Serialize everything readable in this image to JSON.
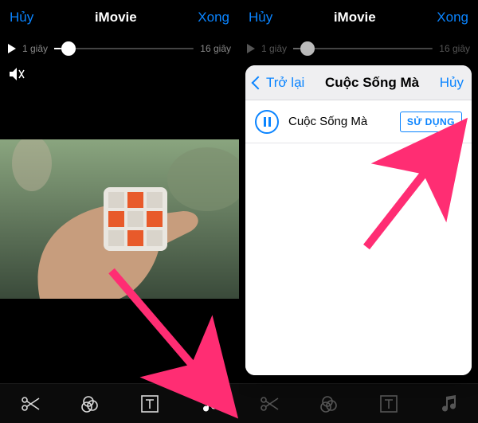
{
  "left": {
    "nav": {
      "cancel": "Hủy",
      "title": "iMovie",
      "done": "Xong"
    },
    "scrub": {
      "start": "1 giây",
      "end": "16 giây",
      "progress": 0.1
    }
  },
  "right": {
    "nav": {
      "cancel": "Hủy",
      "title": "iMovie",
      "done": "Xong"
    },
    "scrub": {
      "start": "1 giây",
      "end": "16 giây",
      "progress": 0.1
    },
    "popup": {
      "back": "Trở lại",
      "title": "Cuộc Sống Mà",
      "cancel": "Hủy",
      "track": {
        "name": "Cuộc Sống Mà",
        "use": "SỬ DỤNG"
      }
    }
  },
  "toolbar_icons": [
    "scissors-icon",
    "filters-icon",
    "text-icon",
    "music-icon"
  ]
}
